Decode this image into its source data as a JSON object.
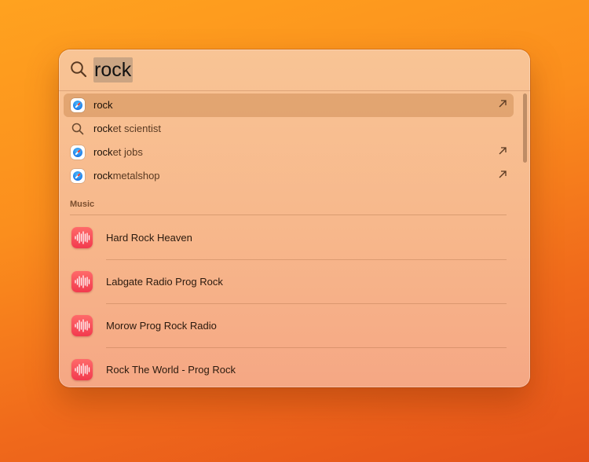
{
  "spotlight": {
    "query": "rock",
    "suggestions": [
      {
        "match": "rock",
        "rest": "",
        "icon": "safari-icon",
        "has_arrow": true,
        "selected": true
      },
      {
        "match": "rock",
        "rest": "et scientist",
        "icon": "search-icon",
        "has_arrow": false,
        "selected": false
      },
      {
        "match": "rock",
        "rest": "et jobs",
        "icon": "safari-icon",
        "has_arrow": true,
        "selected": false
      },
      {
        "match": "rock",
        "rest": "metalshop",
        "icon": "safari-icon",
        "has_arrow": true,
        "selected": false
      }
    ],
    "music_section": {
      "label": "Music",
      "items": [
        {
          "title": "Hard Rock Heaven",
          "icon": "radio-waveform-icon"
        },
        {
          "title": "Labgate Radio Prog Rock",
          "icon": "radio-waveform-icon"
        },
        {
          "title": "Morow Prog Rock Radio",
          "icon": "radio-waveform-icon"
        },
        {
          "title": "Rock The World - Prog Rock",
          "icon": "radio-waveform-icon"
        }
      ]
    }
  },
  "colors": {
    "background_top": "#ffa21f",
    "background_bottom": "#e4521a",
    "panel": "#f8c495",
    "music_icon": "#f23a4e"
  }
}
